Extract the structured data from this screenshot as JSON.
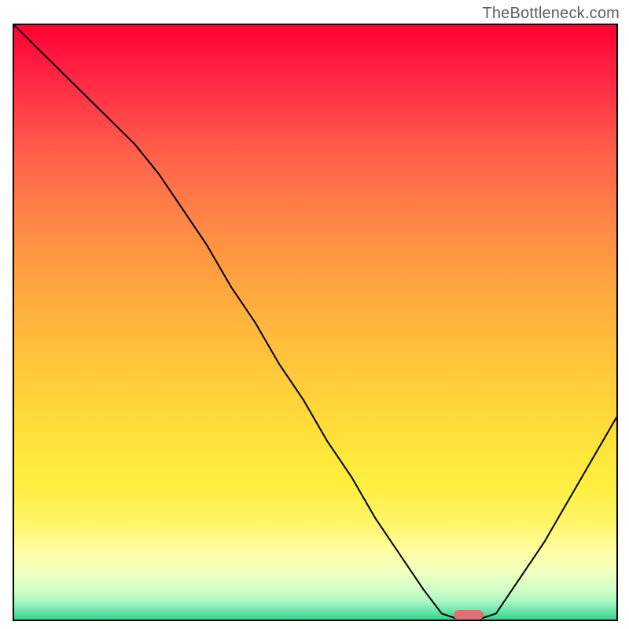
{
  "watermark": "TheBottleneck.com",
  "colors": {
    "curve": "#000000",
    "frame": "#000000",
    "marker": "#e07076"
  },
  "chart_data": {
    "type": "line",
    "title": "",
    "xlabel": "",
    "ylabel": "",
    "xlim": [
      0,
      100
    ],
    "ylim": [
      0,
      100
    ],
    "grid": false,
    "series": [
      {
        "name": "bottleneck-curve",
        "x": [
          0,
          4,
          8,
          12,
          16,
          20,
          24,
          28,
          32,
          36,
          40,
          44,
          48,
          52,
          56,
          60,
          64,
          68,
          71,
          74,
          77,
          80,
          84,
          88,
          92,
          96,
          100
        ],
        "y": [
          100,
          96,
          92,
          88,
          84,
          80,
          75,
          69,
          63,
          56,
          50,
          43,
          37,
          30,
          24,
          17,
          11,
          5,
          1,
          0,
          0,
          1,
          7,
          13,
          20,
          27,
          34
        ]
      }
    ],
    "marker": {
      "x": 75.5,
      "y": 0.8
    }
  }
}
